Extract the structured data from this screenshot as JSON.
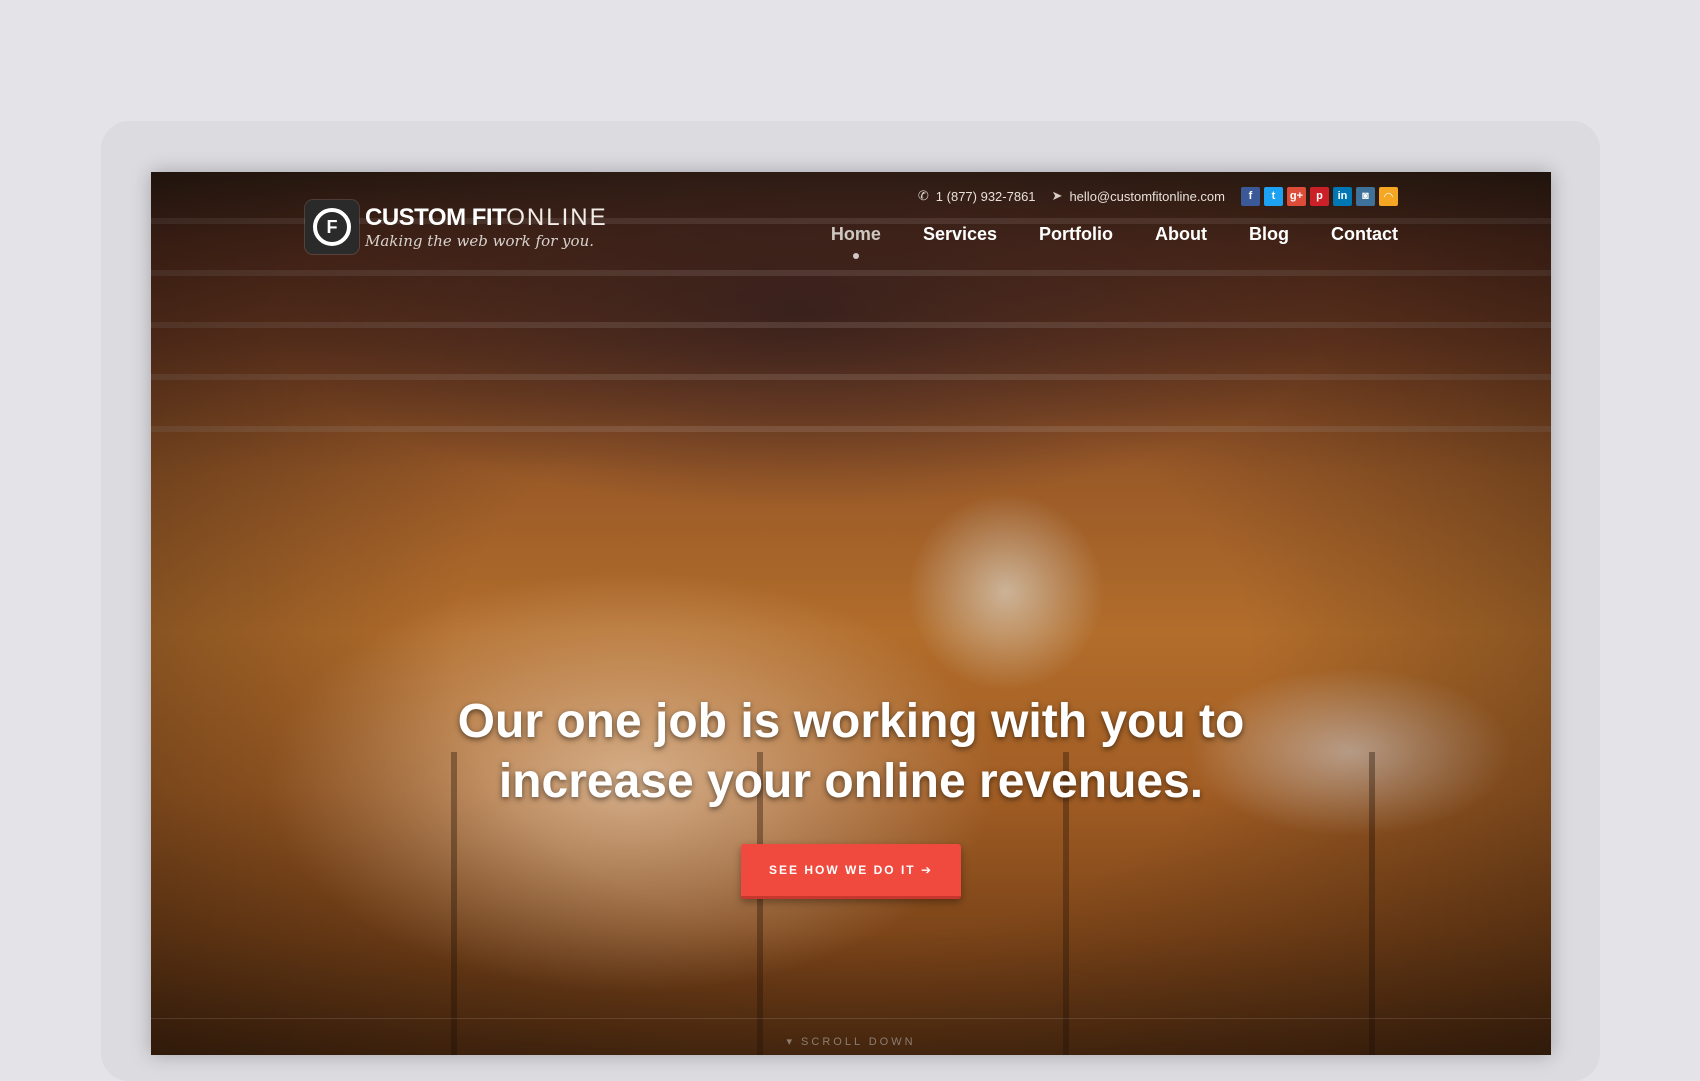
{
  "header": {
    "phone": "1 (877) 932-7861",
    "email": "hello@customfitonline.com",
    "social": [
      {
        "icon": "facebook-icon",
        "glyph": "f",
        "color": "#3b5998"
      },
      {
        "icon": "twitter-icon",
        "glyph": "t",
        "color": "#1da1f2"
      },
      {
        "icon": "googleplus-icon",
        "glyph": "g+",
        "color": "#dd4b39"
      },
      {
        "icon": "pinterest-icon",
        "glyph": "p",
        "color": "#cb2027"
      },
      {
        "icon": "linkedin-icon",
        "glyph": "in",
        "color": "#0077b5"
      },
      {
        "icon": "instagram-icon",
        "glyph": "◙",
        "color": "#3f729b"
      },
      {
        "icon": "rss-icon",
        "glyph": "◠",
        "color": "#f5a623"
      }
    ]
  },
  "logo": {
    "mark": "F",
    "name_bold": "CUSTOM FIT",
    "name_light": "ONLINE",
    "tagline": "Making the web work for you."
  },
  "nav": {
    "items": [
      "Home",
      "Services",
      "Portfolio",
      "About",
      "Blog",
      "Contact"
    ],
    "active": "Home"
  },
  "hero": {
    "headline": "Our one job is working with you to increase your online revenues.",
    "cta": "SEE HOW WE DO IT ➔"
  },
  "scroll": {
    "label": "SCROLL DOWN"
  }
}
